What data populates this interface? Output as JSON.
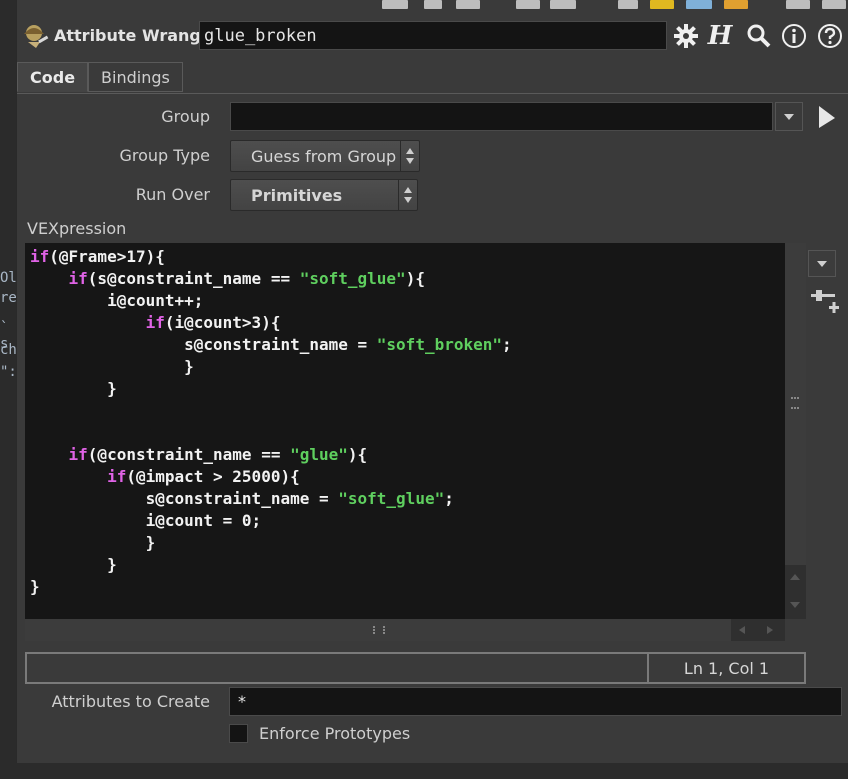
{
  "left_fragments": [
    "Ol",
    "re",
    "` s",
    "ch",
    "\":l"
  ],
  "header": {
    "node_type": "Attribute Wrangle",
    "node_name": "glue_broken",
    "help_h": "H"
  },
  "tabs": [
    {
      "label": "Code",
      "active": true
    },
    {
      "label": "Bindings",
      "active": false
    }
  ],
  "params": {
    "group_label": "Group",
    "group_value": "",
    "group_type_label": "Group Type",
    "group_type_value": "Guess from Group",
    "run_over_label": "Run Over",
    "run_over_value": "Primitives",
    "vex_label": "VEXpression"
  },
  "code_lines": [
    [
      [
        "kw",
        "if"
      ],
      [
        "t",
        "(@Frame>17){"
      ]
    ],
    [
      [
        "t",
        "    "
      ],
      [
        "kw",
        "if"
      ],
      [
        "t",
        "(s@constraint_name == "
      ],
      [
        "str",
        "\"soft_glue\""
      ],
      [
        "t",
        "){"
      ]
    ],
    [
      [
        "t",
        "        i@count++;"
      ]
    ],
    [
      [
        "t",
        "            "
      ],
      [
        "kw",
        "if"
      ],
      [
        "t",
        "(i@count>3){"
      ]
    ],
    [
      [
        "t",
        "                s@constraint_name = "
      ],
      [
        "str",
        "\"soft_broken\""
      ],
      [
        "t",
        ";"
      ]
    ],
    [
      [
        "t",
        "                }"
      ]
    ],
    [
      [
        "t",
        "        }"
      ]
    ],
    [
      [
        "t",
        ""
      ]
    ],
    [
      [
        "t",
        ""
      ]
    ],
    [
      [
        "t",
        "    "
      ],
      [
        "kw",
        "if"
      ],
      [
        "t",
        "(@constraint_name == "
      ],
      [
        "str",
        "\"glue\""
      ],
      [
        "t",
        "){"
      ]
    ],
    [
      [
        "t",
        "        "
      ],
      [
        "kw",
        "if"
      ],
      [
        "t",
        "(@impact > 25000){"
      ]
    ],
    [
      [
        "t",
        "            s@constraint_name = "
      ],
      [
        "str",
        "\"soft_glue\""
      ],
      [
        "t",
        ";"
      ]
    ],
    [
      [
        "t",
        "            i@count = 0;"
      ]
    ],
    [
      [
        "t",
        "            }"
      ]
    ],
    [
      [
        "t",
        "        }"
      ]
    ],
    [
      [
        "t",
        "}"
      ]
    ]
  ],
  "status": {
    "cursor_position": "Ln 1, Col 1"
  },
  "attributes_to_create": {
    "label": "Attributes to Create",
    "value": "*"
  },
  "enforce_prototypes": {
    "label": "Enforce Prototypes",
    "checked": false
  },
  "colors": {
    "keyword": "#e063e6",
    "string": "#5fcf5f",
    "code_bg": "#161616",
    "panel_bg": "#3a3a3a"
  }
}
